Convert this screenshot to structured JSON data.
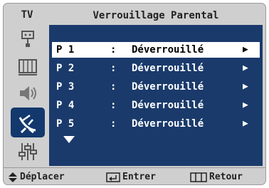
{
  "header": {
    "tv_label": "TV",
    "title": "Verrouillage Parental"
  },
  "sidebar": {
    "icons": [
      "input-icon",
      "picture-icon",
      "sound-icon",
      "channel-icon",
      "setup-icon"
    ],
    "active_index": 3
  },
  "channels": [
    {
      "name": "P 1",
      "sep": ":",
      "status": "Déverrouillé",
      "selected": true
    },
    {
      "name": "P 2",
      "sep": ":",
      "status": "Déverrouillé",
      "selected": false
    },
    {
      "name": "P 3",
      "sep": ":",
      "status": "Déverrouillé",
      "selected": false
    },
    {
      "name": "P 4",
      "sep": ":",
      "status": "Déverrouillé",
      "selected": false
    },
    {
      "name": "P 5",
      "sep": ":",
      "status": "Déverrouillé",
      "selected": false
    }
  ],
  "footer": {
    "move_label": "Déplacer",
    "enter_label": "Entrer",
    "return_label": "Retour"
  },
  "colors": {
    "panel": "#1a3a6b",
    "osd_bg": "#cfcfcf",
    "selected_row": "#ffffff"
  }
}
